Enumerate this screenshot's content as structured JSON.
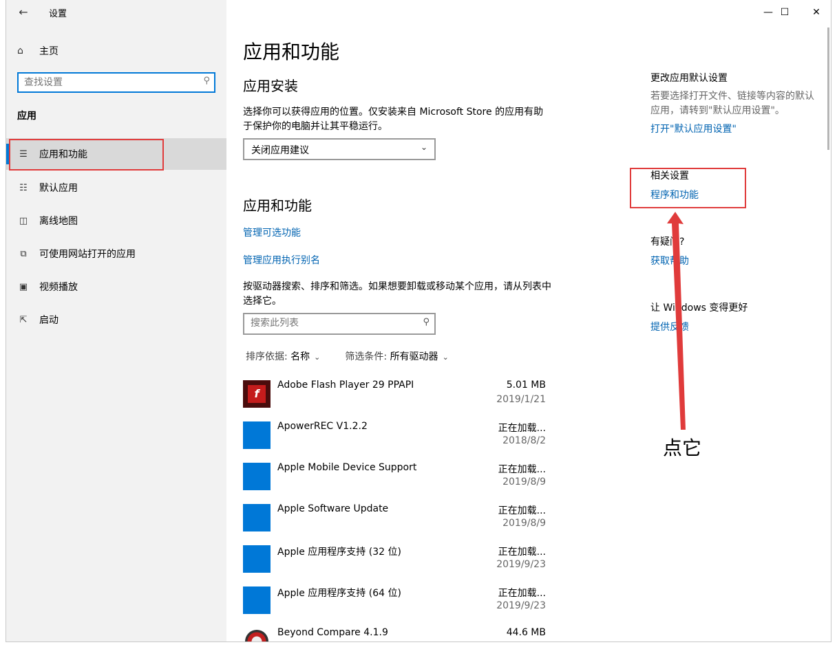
{
  "window": {
    "title": "设置",
    "back_icon": "back-arrow-icon",
    "controls": [
      "minimize-icon",
      "maximize-icon",
      "close-icon"
    ]
  },
  "sidebar": {
    "home": "主页",
    "search_placeholder": "查找设置",
    "section": "应用",
    "items": [
      {
        "label": "应用和功能",
        "icon": "apps-list-icon",
        "active": true
      },
      {
        "label": "默认应用",
        "icon": "default-apps-icon"
      },
      {
        "label": "离线地图",
        "icon": "map-icon"
      },
      {
        "label": "可使用网站打开的应用",
        "icon": "open-website-icon"
      },
      {
        "label": "视频播放",
        "icon": "video-icon"
      },
      {
        "label": "启动",
        "icon": "startup-icon"
      }
    ]
  },
  "main": {
    "title": "应用和功能",
    "install": {
      "heading": "应用安装",
      "description": "选择你可以获得应用的位置。仅安装来自 Microsoft Store 的应用有助于保护你的电脑并让其平稳运行。",
      "dropdown_value": "关闭应用建议"
    },
    "features": {
      "heading": "应用和功能",
      "link_optional": "管理可选功能",
      "link_alias": "管理应用执行别名",
      "description": "按驱动器搜索、排序和筛选。如果想要卸载或移动某个应用，请从列表中选择它。",
      "search_placeholder": "搜索此列表",
      "sort_label": "排序依据:",
      "sort_value": "名称",
      "filter_label": "筛选条件:",
      "filter_value": "所有驱动器"
    },
    "apps": [
      {
        "name": "Adobe Flash Player 29 PPAPI",
        "size": "5.01 MB",
        "date": "2019/1/21"
      },
      {
        "name": "ApowerREC V1.2.2",
        "size": "正在加载...",
        "date": "2018/8/2"
      },
      {
        "name": "Apple Mobile Device Support",
        "size": "正在加载...",
        "date": "2019/8/9"
      },
      {
        "name": "Apple Software Update",
        "size": "正在加载...",
        "date": "2019/8/9"
      },
      {
        "name": "Apple 应用程序支持 (32 位)",
        "size": "正在加载...",
        "date": "2019/9/23"
      },
      {
        "name": "Apple 应用程序支持 (64 位)",
        "size": "正在加载...",
        "date": "2019/9/23"
      },
      {
        "name": "Beyond Compare 4.1.9",
        "size": "44.6 MB",
        "date": ""
      }
    ]
  },
  "right": {
    "default_title": "更改应用默认设置",
    "default_desc": "若要选择打开文件、链接等内容的默认应用，请转到\"默认应用设置\"。",
    "default_link": "打开\"默认应用设置\"",
    "related_title": "相关设置",
    "related_link": "程序和功能",
    "help_title": "有疑问?",
    "help_link": "获取帮助",
    "feedback_title": "让 Windows 变得更好",
    "feedback_link": "提供反馈"
  },
  "annotation": {
    "text": "点它",
    "color": "#e03b3b"
  }
}
